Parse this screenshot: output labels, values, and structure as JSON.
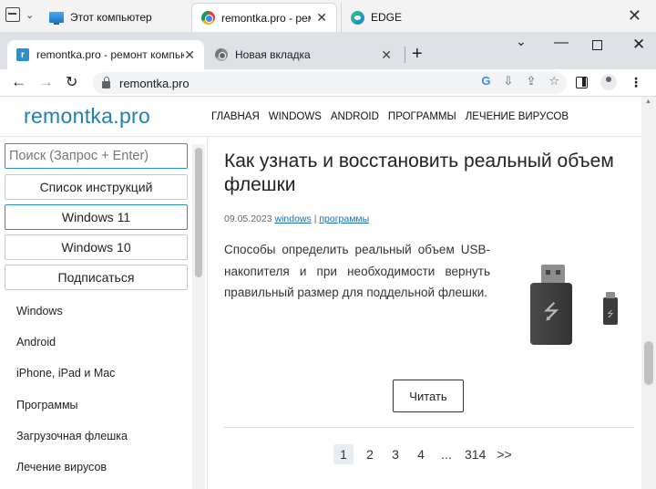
{
  "outer_bar": {
    "tabs": [
      {
        "label": "Этот компьютер"
      },
      {
        "label": "remontka.pro - ремо"
      },
      {
        "label": "EDGE"
      }
    ]
  },
  "tabstrip": {
    "tabs": [
      {
        "label": "remontka.pro - ремонт компьют"
      },
      {
        "label": "Новая вкладка"
      }
    ]
  },
  "toolbar": {
    "url": "remontka.pro"
  },
  "site": {
    "logo": "remontka.pro",
    "nav": [
      "ГЛАВНАЯ",
      "WINDOWS",
      "ANDROID",
      "ПРОГРАММЫ",
      "ЛЕЧЕНИЕ ВИРУСОВ"
    ]
  },
  "sidebar": {
    "search_placeholder": "Поиск (Запрос + Enter)",
    "buttons": [
      "Список инструкций",
      "Windows 11",
      "Windows 10",
      "Подписаться"
    ],
    "links": [
      "Windows",
      "Android",
      "iPhone, iPad и Mac",
      "Программы",
      "Загрузочная флешка",
      "Лечение вирусов"
    ]
  },
  "article": {
    "title": "Как узнать и восстановить реальный объем флешки",
    "date": "09.05.2023",
    "cat1": "windows",
    "sep": "|",
    "cat2": "программы",
    "excerpt": "Способы определить реальный объем USB-накопителя и при необходимости вернуть правильный размер для поддельной флешки.",
    "read_label": "Читать"
  },
  "pagination": {
    "pages": [
      "1",
      "2",
      "3",
      "4",
      "...",
      "314",
      ">>"
    ],
    "current": "1"
  }
}
